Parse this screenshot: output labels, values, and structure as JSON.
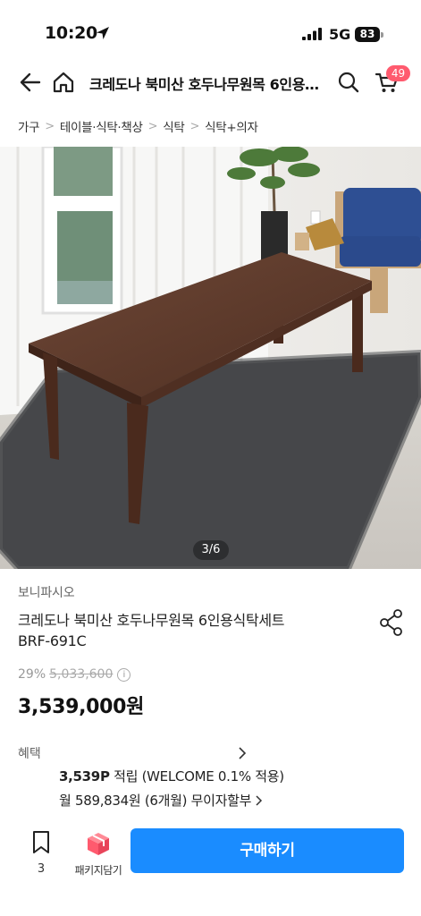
{
  "status_bar": {
    "time": "10:20",
    "network": "5G",
    "battery": "83"
  },
  "header": {
    "title": "크레도나 북미산 호두나무원목 6인용식탁세트 BRF-691C",
    "cart_count": "49"
  },
  "breadcrumb": [
    "가구",
    "테이블·식탁·책상",
    "식탁",
    "식탁+의자"
  ],
  "gallery": {
    "counter": "3/6"
  },
  "product": {
    "brand": "보니파시오",
    "name_line1": "크레도나 북미산 호두나무원목 6인용식탁세트",
    "name_line2": "BRF-691C",
    "discount_rate": "29%",
    "original_price": "5,033,600",
    "sale_price": "3,539,000원"
  },
  "benefits": {
    "label": "혜택",
    "points_value": "3,539P",
    "points_text": "적립 (WELCOME 0.1% 적용)",
    "installment_text": "월 589,834원 (6개월) 무이자할부"
  },
  "bottom_bar": {
    "wish_count": "3",
    "package_label": "패키지담기",
    "buy_label": "구매하기"
  },
  "colors": {
    "accent": "#1a8cff",
    "badge": "#ff5a6e"
  }
}
